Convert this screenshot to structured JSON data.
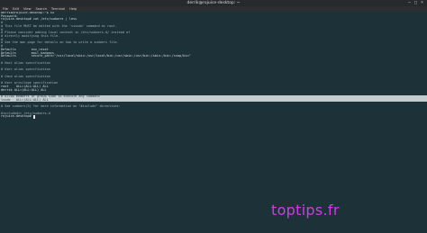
{
  "window": {
    "title": "derrik@rojuice-desktop: ~",
    "controls": {
      "minimize": "–",
      "maximize": "□",
      "close": "×"
    }
  },
  "menu": [
    "File",
    "Edit",
    "View",
    "Search",
    "Terminal",
    "Help"
  ],
  "terminal": {
    "lines": [
      "derrik@rojuice-desktop:~$ su",
      "Password:",
      "rojuice-desktop# cat /etc/sudoers | less",
      "#",
      "# This file MUST be edited with the 'visudo' command as root.",
      "#",
      "# Please consider adding local content in /etc/sudoers.d/ instead of",
      "# directly modifying this file.",
      "#",
      "# See the man page for details on how to write a sudoers file.",
      "#",
      "Defaults        env_reset",
      "Defaults        mail_badpass",
      "Defaults        secure_path=\"/usr/local/sbin:/usr/local/bin:/usr/sbin:/usr/bin:/sbin:/bin:/snap/bin\"",
      "",
      "# Host alias specification",
      "",
      "# User alias specification",
      "",
      "# Cmnd alias specification",
      "",
      "# User privilege specification",
      "root    ALL=(ALL:ALL) ALL",
      "derrik ALL=(ALL:ALL) ALL",
      "",
      "# Allow members of group sudo to execute any command",
      "%sudo   ALL=(ALL:ALL) ALL",
      "",
      "# See sudoers(5) for more information on \"#include\" directives:",
      "",
      "#includedir /etc/sudoers.d",
      "rojuice-desktop# "
    ],
    "highlighted_lines": [
      25,
      26
    ],
    "dim_lines": [
      3,
      4,
      5,
      6,
      7,
      8,
      9,
      10,
      15,
      17,
      19,
      21,
      25,
      28,
      30
    ]
  },
  "watermark": "toptips.fr",
  "colors": {
    "background": "#1c3238",
    "text": "#d6dee0",
    "highlight_bg": "#c4cccf",
    "watermark": "#d13be6"
  }
}
